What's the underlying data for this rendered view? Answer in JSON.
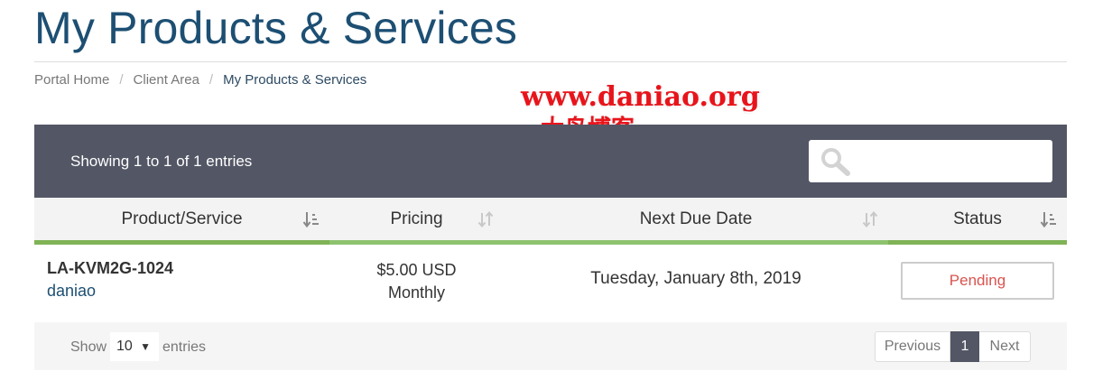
{
  "page": {
    "title": "My Products & Services"
  },
  "breadcrumb": [
    {
      "label": "Portal Home"
    },
    {
      "label": "Client Area"
    },
    {
      "label": "My Products & Services"
    }
  ],
  "watermark": {
    "url": "www.daniao.org",
    "name": "大鸟博客"
  },
  "table": {
    "info": "Showing 1 to 1 of 1 entries",
    "search": {
      "placeholder": "",
      "icon": "search-icon"
    },
    "columns": [
      {
        "label": "Product/Service",
        "sort": "sorted-ascending"
      },
      {
        "label": "Pricing",
        "sort": "sortable"
      },
      {
        "label": "Next Due Date",
        "sort": "sortable"
      },
      {
        "label": "Status",
        "sort": "sorted-ascending"
      }
    ],
    "rows": [
      {
        "product": "LA-KVM2G-1024",
        "domain": "daniao",
        "price": "$5.00 USD",
        "cycle": "Monthly",
        "next_due": "Tuesday, January 8th, 2019",
        "status": "Pending"
      }
    ]
  },
  "footer": {
    "show_label": "Show",
    "page_length": "10",
    "entries_label": "entries",
    "pagination": {
      "previous": "Previous",
      "current": "1",
      "next": "Next"
    }
  },
  "colors": {
    "title": "#1d4f73",
    "header_bar": "#535665",
    "column_underline": "#8dc26f",
    "status_pending": "#d9534f",
    "watermark": "#e8141b"
  }
}
